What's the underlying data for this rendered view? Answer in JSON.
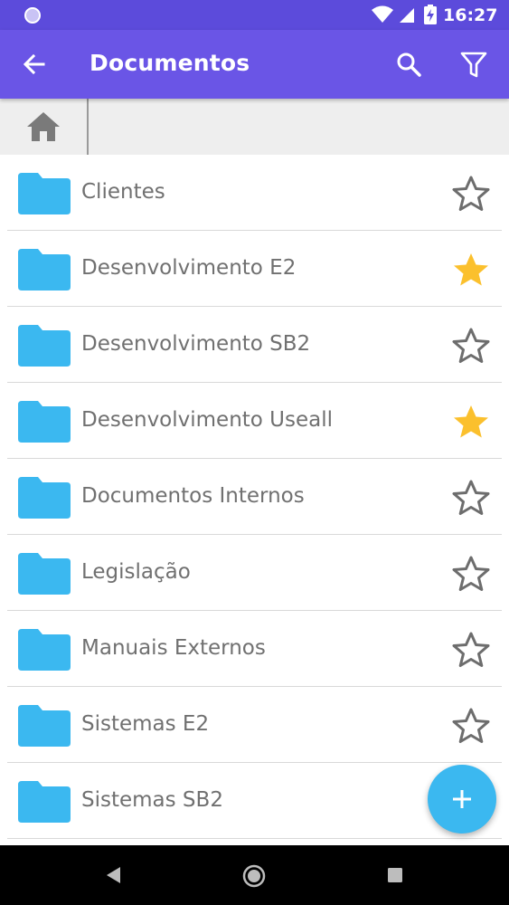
{
  "status_bar": {
    "time": "16:27"
  },
  "app_bar": {
    "title": "Documentos",
    "icons": [
      "arrow-back-icon",
      "search-icon",
      "filter-icon"
    ],
    "color": "#6a55e6"
  },
  "breadcrumb": {
    "icons": [
      "home-icon"
    ]
  },
  "folders": [
    {
      "name": "Clientes",
      "favorite": false
    },
    {
      "name": "Desenvolvimento E2",
      "favorite": true
    },
    {
      "name": "Desenvolvimento SB2",
      "favorite": false
    },
    {
      "name": "Desenvolvimento Useall",
      "favorite": true
    },
    {
      "name": "Documentos Internos",
      "favorite": false
    },
    {
      "name": "Legislação",
      "favorite": false
    },
    {
      "name": "Manuais Externos",
      "favorite": false
    },
    {
      "name": "Sistemas E2",
      "favorite": false
    },
    {
      "name": "Sistemas SB2",
      "favorite": false
    }
  ],
  "colors": {
    "folder": "#3bb8f0",
    "star_favorite": "#fbc02d",
    "star_empty": "#6d6d6d",
    "fab": "#3bb8f0"
  },
  "fab": {
    "icon": "plus-icon"
  }
}
